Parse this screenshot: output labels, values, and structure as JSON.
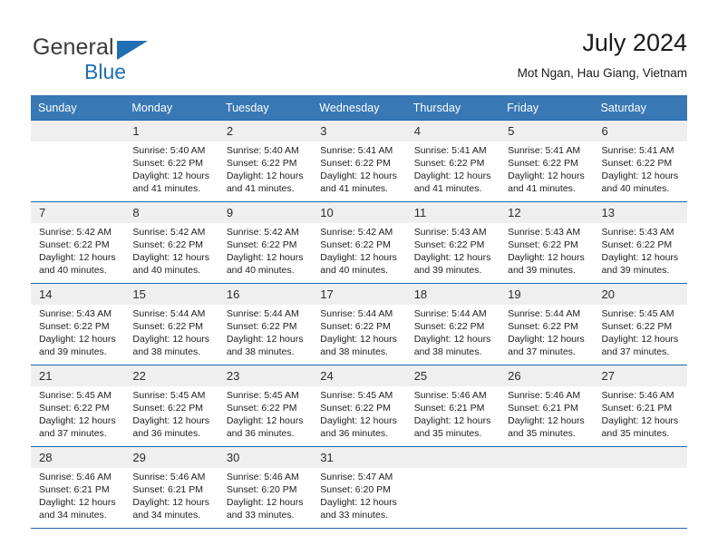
{
  "brand": {
    "name_top": "General",
    "name_bottom": "Blue",
    "triangle_color": "#1f6fb5",
    "text_color": "#3b3b3b"
  },
  "header": {
    "title": "July 2024",
    "subtitle": "Mot Ngan, Hau Giang, Vietnam"
  },
  "theme": {
    "header_bg": "#3778b5",
    "rule_color": "#1d66ab",
    "daynum_bg": "#efefef",
    "text_color": "#202020"
  },
  "columns": [
    "Sunday",
    "Monday",
    "Tuesday",
    "Wednesday",
    "Thursday",
    "Friday",
    "Saturday"
  ],
  "weeks": [
    [
      {
        "day": "",
        "lines": []
      },
      {
        "day": "1",
        "lines": [
          "Sunrise: 5:40 AM",
          "Sunset: 6:22 PM",
          "Daylight: 12 hours",
          "and 41 minutes."
        ]
      },
      {
        "day": "2",
        "lines": [
          "Sunrise: 5:40 AM",
          "Sunset: 6:22 PM",
          "Daylight: 12 hours",
          "and 41 minutes."
        ]
      },
      {
        "day": "3",
        "lines": [
          "Sunrise: 5:41 AM",
          "Sunset: 6:22 PM",
          "Daylight: 12 hours",
          "and 41 minutes."
        ]
      },
      {
        "day": "4",
        "lines": [
          "Sunrise: 5:41 AM",
          "Sunset: 6:22 PM",
          "Daylight: 12 hours",
          "and 41 minutes."
        ]
      },
      {
        "day": "5",
        "lines": [
          "Sunrise: 5:41 AM",
          "Sunset: 6:22 PM",
          "Daylight: 12 hours",
          "and 41 minutes."
        ]
      },
      {
        "day": "6",
        "lines": [
          "Sunrise: 5:41 AM",
          "Sunset: 6:22 PM",
          "Daylight: 12 hours",
          "and 40 minutes."
        ]
      }
    ],
    [
      {
        "day": "7",
        "lines": [
          "Sunrise: 5:42 AM",
          "Sunset: 6:22 PM",
          "Daylight: 12 hours",
          "and 40 minutes."
        ]
      },
      {
        "day": "8",
        "lines": [
          "Sunrise: 5:42 AM",
          "Sunset: 6:22 PM",
          "Daylight: 12 hours",
          "and 40 minutes."
        ]
      },
      {
        "day": "9",
        "lines": [
          "Sunrise: 5:42 AM",
          "Sunset: 6:22 PM",
          "Daylight: 12 hours",
          "and 40 minutes."
        ]
      },
      {
        "day": "10",
        "lines": [
          "Sunrise: 5:42 AM",
          "Sunset: 6:22 PM",
          "Daylight: 12 hours",
          "and 40 minutes."
        ]
      },
      {
        "day": "11",
        "lines": [
          "Sunrise: 5:43 AM",
          "Sunset: 6:22 PM",
          "Daylight: 12 hours",
          "and 39 minutes."
        ]
      },
      {
        "day": "12",
        "lines": [
          "Sunrise: 5:43 AM",
          "Sunset: 6:22 PM",
          "Daylight: 12 hours",
          "and 39 minutes."
        ]
      },
      {
        "day": "13",
        "lines": [
          "Sunrise: 5:43 AM",
          "Sunset: 6:22 PM",
          "Daylight: 12 hours",
          "and 39 minutes."
        ]
      }
    ],
    [
      {
        "day": "14",
        "lines": [
          "Sunrise: 5:43 AM",
          "Sunset: 6:22 PM",
          "Daylight: 12 hours",
          "and 39 minutes."
        ]
      },
      {
        "day": "15",
        "lines": [
          "Sunrise: 5:44 AM",
          "Sunset: 6:22 PM",
          "Daylight: 12 hours",
          "and 38 minutes."
        ]
      },
      {
        "day": "16",
        "lines": [
          "Sunrise: 5:44 AM",
          "Sunset: 6:22 PM",
          "Daylight: 12 hours",
          "and 38 minutes."
        ]
      },
      {
        "day": "17",
        "lines": [
          "Sunrise: 5:44 AM",
          "Sunset: 6:22 PM",
          "Daylight: 12 hours",
          "and 38 minutes."
        ]
      },
      {
        "day": "18",
        "lines": [
          "Sunrise: 5:44 AM",
          "Sunset: 6:22 PM",
          "Daylight: 12 hours",
          "and 38 minutes."
        ]
      },
      {
        "day": "19",
        "lines": [
          "Sunrise: 5:44 AM",
          "Sunset: 6:22 PM",
          "Daylight: 12 hours",
          "and 37 minutes."
        ]
      },
      {
        "day": "20",
        "lines": [
          "Sunrise: 5:45 AM",
          "Sunset: 6:22 PM",
          "Daylight: 12 hours",
          "and 37 minutes."
        ]
      }
    ],
    [
      {
        "day": "21",
        "lines": [
          "Sunrise: 5:45 AM",
          "Sunset: 6:22 PM",
          "Daylight: 12 hours",
          "and 37 minutes."
        ]
      },
      {
        "day": "22",
        "lines": [
          "Sunrise: 5:45 AM",
          "Sunset: 6:22 PM",
          "Daylight: 12 hours",
          "and 36 minutes."
        ]
      },
      {
        "day": "23",
        "lines": [
          "Sunrise: 5:45 AM",
          "Sunset: 6:22 PM",
          "Daylight: 12 hours",
          "and 36 minutes."
        ]
      },
      {
        "day": "24",
        "lines": [
          "Sunrise: 5:45 AM",
          "Sunset: 6:22 PM",
          "Daylight: 12 hours",
          "and 36 minutes."
        ]
      },
      {
        "day": "25",
        "lines": [
          "Sunrise: 5:46 AM",
          "Sunset: 6:21 PM",
          "Daylight: 12 hours",
          "and 35 minutes."
        ]
      },
      {
        "day": "26",
        "lines": [
          "Sunrise: 5:46 AM",
          "Sunset: 6:21 PM",
          "Daylight: 12 hours",
          "and 35 minutes."
        ]
      },
      {
        "day": "27",
        "lines": [
          "Sunrise: 5:46 AM",
          "Sunset: 6:21 PM",
          "Daylight: 12 hours",
          "and 35 minutes."
        ]
      }
    ],
    [
      {
        "day": "28",
        "lines": [
          "Sunrise: 5:46 AM",
          "Sunset: 6:21 PM",
          "Daylight: 12 hours",
          "and 34 minutes."
        ]
      },
      {
        "day": "29",
        "lines": [
          "Sunrise: 5:46 AM",
          "Sunset: 6:21 PM",
          "Daylight: 12 hours",
          "and 34 minutes."
        ]
      },
      {
        "day": "30",
        "lines": [
          "Sunrise: 5:46 AM",
          "Sunset: 6:20 PM",
          "Daylight: 12 hours",
          "and 33 minutes."
        ]
      },
      {
        "day": "31",
        "lines": [
          "Sunrise: 5:47 AM",
          "Sunset: 6:20 PM",
          "Daylight: 12 hours",
          "and 33 minutes."
        ]
      },
      {
        "day": "",
        "lines": []
      },
      {
        "day": "",
        "lines": []
      },
      {
        "day": "",
        "lines": []
      }
    ]
  ]
}
